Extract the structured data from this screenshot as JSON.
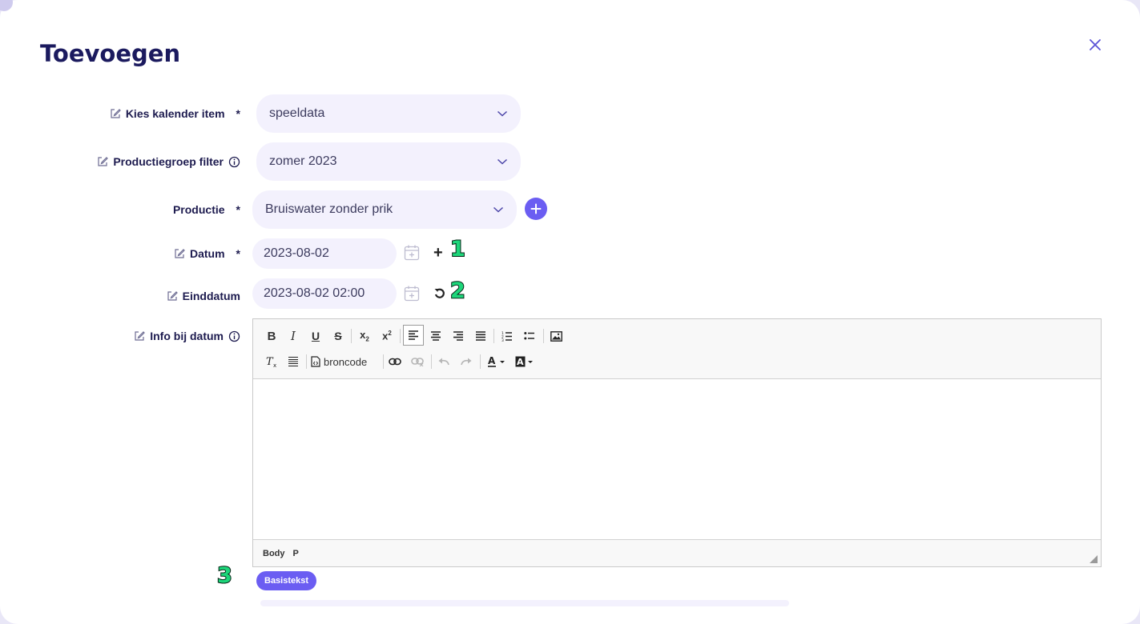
{
  "modal": {
    "title": "Toevoegen"
  },
  "fields": {
    "kalender": {
      "label": "Kies kalender item",
      "required": "*",
      "value": "speeldata"
    },
    "groep": {
      "label": "Productiegroep filter",
      "value": "zomer 2023"
    },
    "productie": {
      "label": "Productie",
      "required": "*",
      "value": "Bruiswater zonder prik"
    },
    "datum": {
      "label": "Datum",
      "required": "*",
      "value": "2023-08-02",
      "action": "+"
    },
    "einddatum": {
      "label": "Einddatum",
      "value": "2023-08-02 02:00"
    },
    "info": {
      "label": "Info bij datum"
    }
  },
  "editor": {
    "source_label": "broncode",
    "path": [
      "Body",
      "P"
    ]
  },
  "chip": {
    "label": "Basistekst"
  },
  "annotations": [
    "1",
    "2",
    "3"
  ],
  "colors": {
    "accent": "#6b5df2",
    "title": "#1b1a5e",
    "input_bg": "#f3f1fd",
    "annotation": "#1dd67a"
  }
}
